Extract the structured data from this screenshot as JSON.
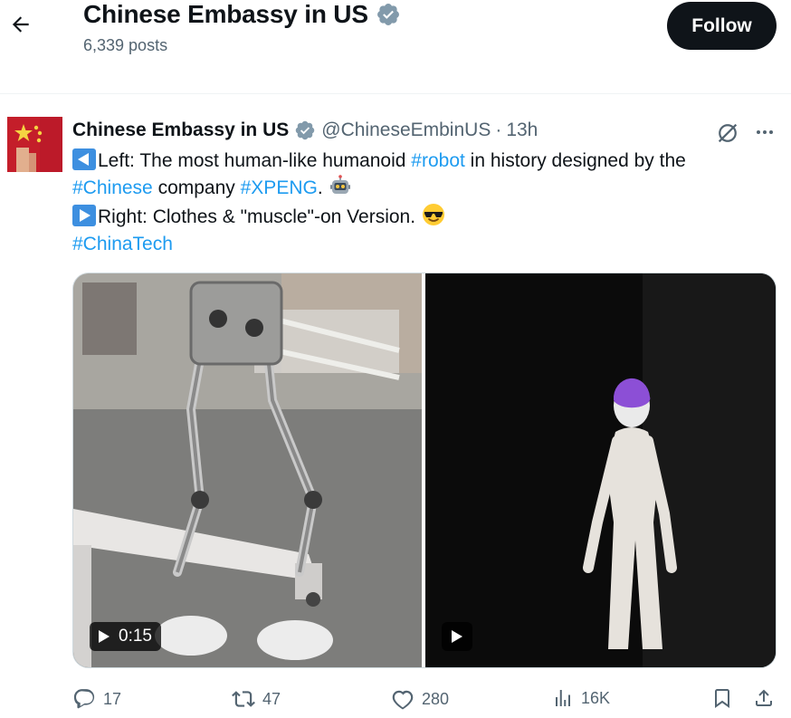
{
  "header": {
    "title": "Chinese Embassy in US",
    "posts": "6,339 posts",
    "follow_label": "Follow"
  },
  "tweet": {
    "name": "Chinese Embassy in US",
    "handle": "@ChineseEmbinUS",
    "separator": "·",
    "time": "13h",
    "text": {
      "line1_pre": "Left: The most human-like humanoid ",
      "line1_tag": "#robot",
      "line1_post": " in history designed by the",
      "line2_tag1": "#Chinese",
      "line2_mid": " company ",
      "line2_tag2": "#XPENG",
      "line2_post": ". ",
      "line3": "Right: Clothes & \"muscle\"-on Version. ",
      "line4_tag": "#ChinaTech"
    },
    "media": {
      "left_duration": "0:15"
    },
    "actions": {
      "replies": "17",
      "reposts": "47",
      "likes": "280",
      "views": "16K"
    }
  },
  "colors": {
    "accent": "#1d9bf0",
    "text": "#0f1419",
    "muted": "#536471",
    "follow_bg": "#0f1419"
  },
  "icons": [
    "back-arrow-icon",
    "verified-badge-icon",
    "grok-icon",
    "more-icon",
    "play-icon",
    "reply-icon",
    "repost-icon",
    "like-icon",
    "views-icon",
    "bookmark-icon",
    "share-icon"
  ]
}
